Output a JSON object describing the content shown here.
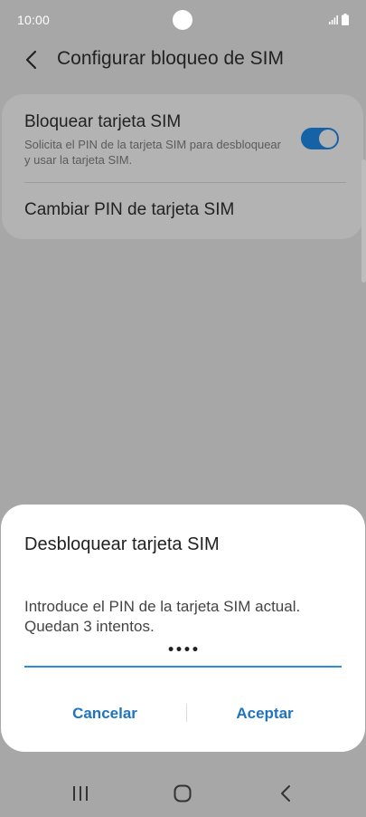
{
  "status_bar": {
    "time": "10:00",
    "icons": [
      "signal-icon",
      "battery-icon"
    ]
  },
  "header": {
    "back_icon": "chevron-left-icon",
    "title": "Configurar bloqueo de SIM"
  },
  "settings": {
    "lock_sim": {
      "title": "Bloquear tarjeta SIM",
      "description": "Solicita el PIN de la tarjeta SIM para desbloquear y usar la tarjeta SIM.",
      "toggle_on": true
    },
    "change_pin": {
      "label": "Cambiar PIN de tarjeta SIM"
    }
  },
  "dialog": {
    "title": "Desbloquear tarjeta SIM",
    "message": "Introduce el PIN de la tarjeta SIM actual. Quedan 3 intentos.",
    "pin_value": "••••",
    "cancel_label": "Cancelar",
    "accept_label": "Aceptar"
  },
  "nav_bar": {
    "icons": [
      "recent-apps-icon",
      "home-icon",
      "back-icon"
    ]
  },
  "colors": {
    "accent": "#1f73c1",
    "toggle_on": "#1662a6",
    "input_underline": "#2d8dd8",
    "scrim_background": "#a7a7a7"
  }
}
